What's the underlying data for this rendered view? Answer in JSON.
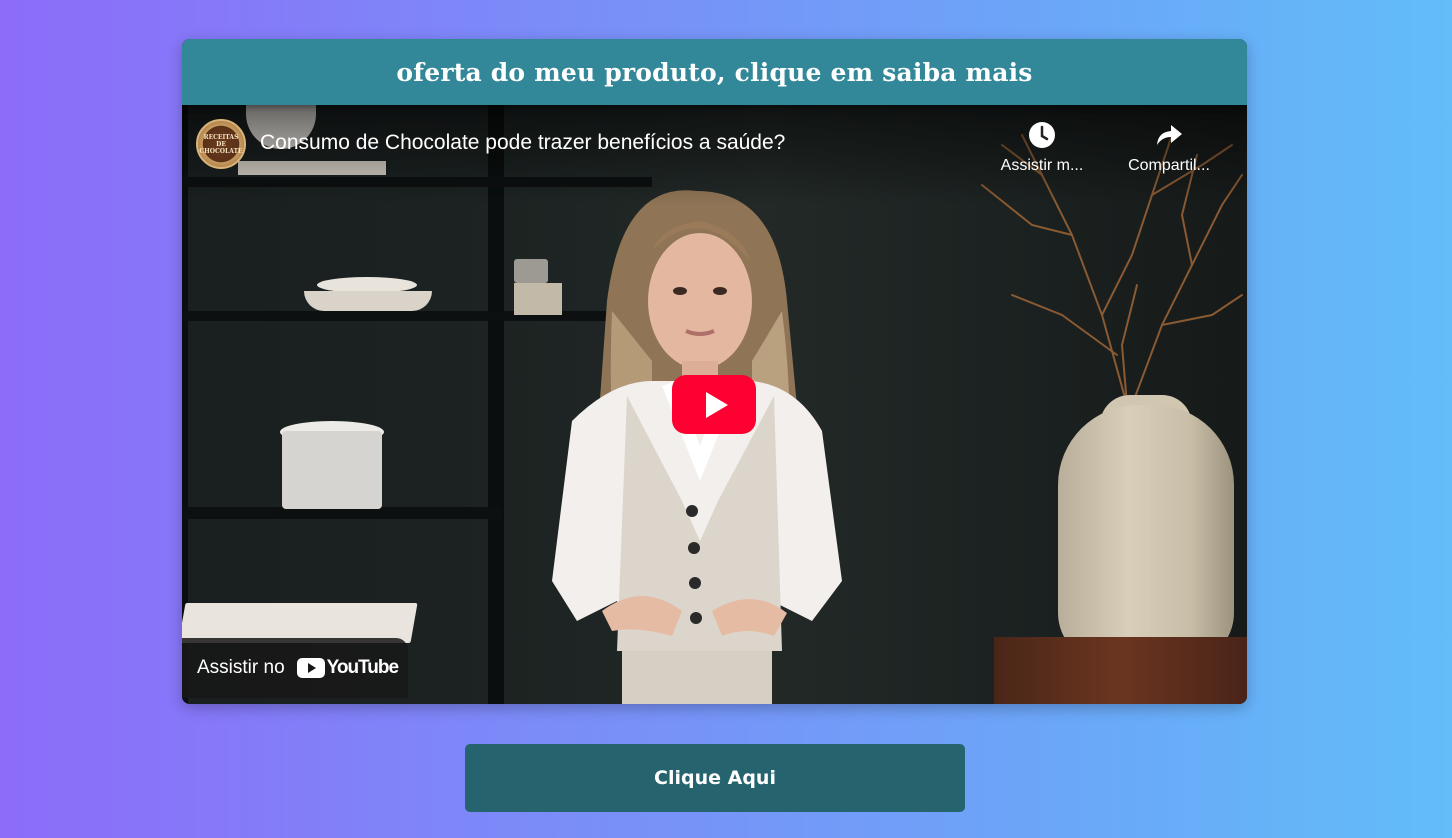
{
  "header": {
    "title": "oferta do meu produto, clique em saiba mais"
  },
  "video": {
    "title": "Consumo de Chocolate pode trazer benefícios a saúde?",
    "channel_avatar_text": "RECEITAS DE CHOCOLATE",
    "actions": [
      {
        "label": "Assistir m...",
        "icon": "clock-icon"
      },
      {
        "label": "Compartil...",
        "icon": "share-icon"
      }
    ],
    "watch_on_label": "Assistir no",
    "watch_on_brand": "YouTube",
    "play_button_color": "#ff0033"
  },
  "cta": {
    "label": "Clique Aqui"
  },
  "colors": {
    "header_bg": "#328899",
    "cta_bg": "#25636f",
    "page_gradient_start": "#8c6cf9",
    "page_gradient_end": "#62bdf9"
  }
}
